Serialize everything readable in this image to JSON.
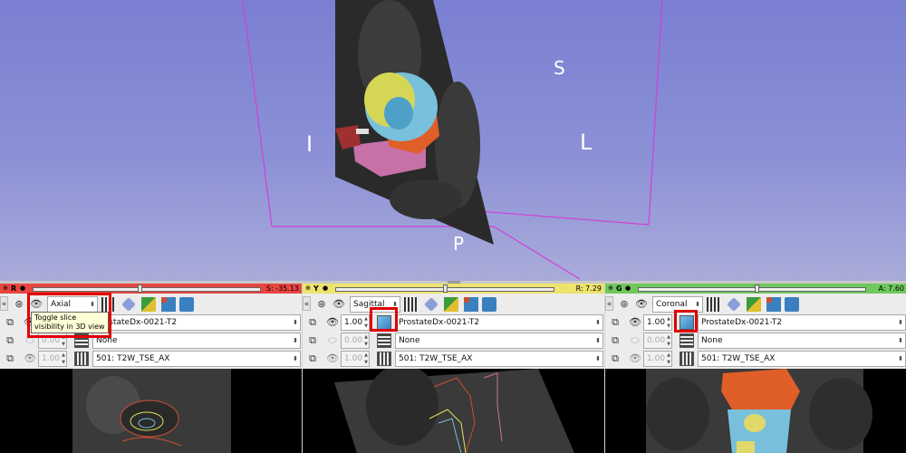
{
  "view3d": {
    "orientation_labels": {
      "superior": "S",
      "inferior": "I",
      "left": "L",
      "posterior": "P"
    },
    "background_top": "#7a7fd2",
    "box_color": "#d040d8"
  },
  "collapse_glyph": "«",
  "panels": [
    {
      "id": "red",
      "letter": "R",
      "bar_color": "#e8453f",
      "offset_value": "S: -35.13",
      "slider_fraction": 0.47,
      "orientation": "Axial",
      "foreground_opacity": "1.00",
      "foreground_volume": "ProstateDx-0021-T2",
      "label_opacity": "0.00",
      "label_volume": "None",
      "background_opacity": "1.00",
      "background_volume": "501: T2W_TSE_AX",
      "tooltip": {
        "line1": "Toggle slice",
        "line2": "visibility in 3D view"
      }
    },
    {
      "id": "yellow",
      "letter": "Y",
      "bar_color": "#ede36d",
      "offset_value": "R: 7.29",
      "slider_fraction": 0.5,
      "orientation": "Sagittal",
      "foreground_opacity": "1.00",
      "foreground_volume": "ProstateDx-0021-T2",
      "label_opacity": "0.00",
      "label_volume": "None",
      "background_opacity": "1.00",
      "background_volume": "501: T2W_TSE_AX"
    },
    {
      "id": "green",
      "letter": "G",
      "bar_color": "#6ec85c",
      "offset_value": "A: 7.60",
      "slider_fraction": 0.52,
      "orientation": "Coronal",
      "foreground_opacity": "1.00",
      "foreground_volume": "ProstateDx-0021-T2",
      "label_opacity": "0.00",
      "label_volume": "None",
      "background_opacity": "1.00",
      "background_volume": "501: T2W_TSE_AX"
    }
  ]
}
